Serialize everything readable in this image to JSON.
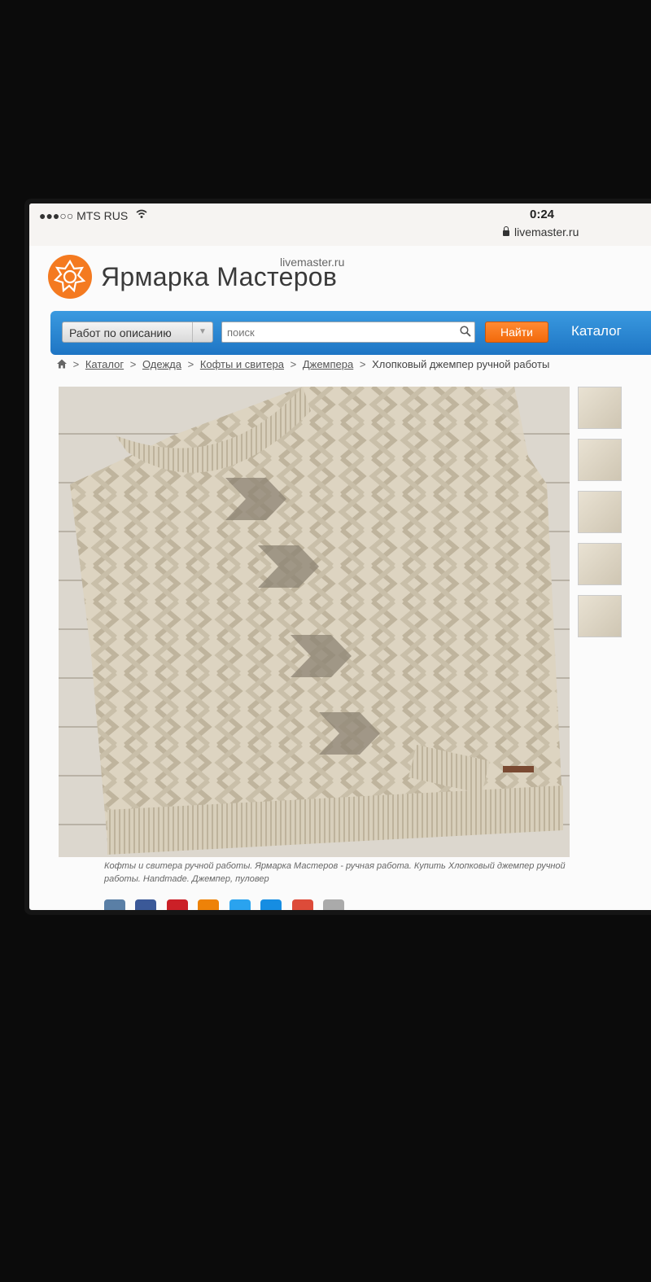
{
  "status_bar": {
    "carrier": "●●●○○ MTS RUS",
    "time": "0:24",
    "url": "livemaster.ru"
  },
  "header": {
    "brand": "Ярмарка Мастеров",
    "domain": "livemaster.ru"
  },
  "search": {
    "select_value": "Работ по описанию",
    "placeholder": "поиск",
    "find_label": "Найти",
    "catalog_label": "Каталог"
  },
  "breadcrumb": {
    "items": [
      "Каталог",
      "Одежда",
      "Кофты и свитера",
      "Джемпера"
    ],
    "current": "Хлопковый джемпер ручной работы",
    "separator": ">"
  },
  "caption": "Кофты и свитера ручной работы. Ярмарка Мастеров - ручная работа. Купить Хлопковый джемпер ручной работы. Handmade. Джемпер, пуловер",
  "colors": {
    "accent_blue": "#1e75c4",
    "accent_orange": "#f26a0b",
    "logo_orange": "#f47a20"
  },
  "icons": [
    "wifi-icon",
    "lock-icon",
    "logo-icon",
    "search-icon",
    "home-icon"
  ]
}
